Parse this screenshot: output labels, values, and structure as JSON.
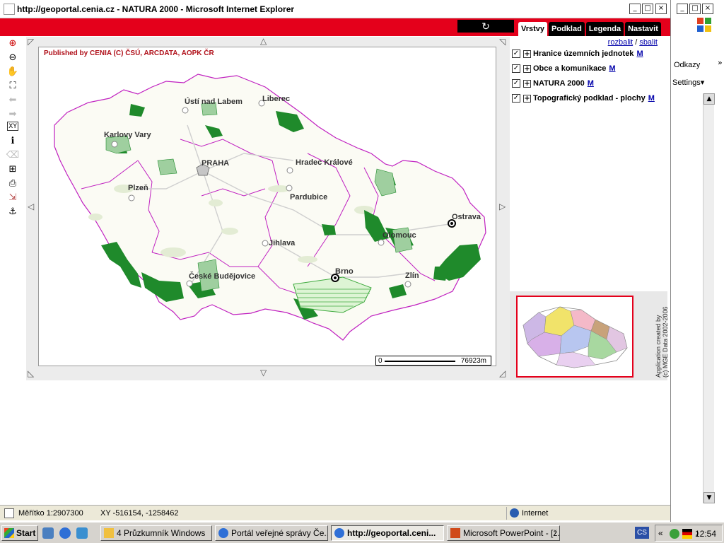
{
  "window": {
    "title": "http://geoportal.cenia.cz - NATURA 2000 - Microsoft Internet Explorer",
    "min": "_",
    "max": "□",
    "close": "×"
  },
  "app": {
    "refresh_glyph": "↻",
    "tabs": [
      {
        "label": "Vrstvy",
        "active": true
      },
      {
        "label": "Podklad",
        "active": false
      },
      {
        "label": "Legenda",
        "active": false
      },
      {
        "label": "Nastavit",
        "active": false
      }
    ]
  },
  "toolbar": {
    "tools": [
      {
        "name": "zoom-in-tool",
        "glyph": "⊕"
      },
      {
        "name": "zoom-out-tool",
        "glyph": "⊖"
      },
      {
        "name": "pan-tool",
        "glyph": "✋"
      },
      {
        "name": "full-extent-tool",
        "glyph": "⛶"
      },
      {
        "name": "back-tool",
        "glyph": "⬅"
      },
      {
        "name": "forward-tool",
        "glyph": "➡"
      },
      {
        "name": "xy-tool",
        "glyph": "XY"
      },
      {
        "name": "info-tool",
        "glyph": "ℹ"
      },
      {
        "name": "eraser-tool",
        "glyph": "⌫"
      },
      {
        "name": "measure-tool",
        "glyph": "⊞"
      },
      {
        "name": "print-tool",
        "glyph": "⎙"
      },
      {
        "name": "export-tool",
        "glyph": "⇲"
      },
      {
        "name": "anchor-tool",
        "glyph": "⚓"
      }
    ]
  },
  "map": {
    "credit": "Published by CENIA    (C) ČSÚ, ARCDATA, AOPK ČR",
    "scale_zero": "0",
    "scale_distance": "76923m",
    "cities": [
      {
        "name": "Ústí nad Labem",
        "key": "usti"
      },
      {
        "name": "Liberec",
        "key": "liberec"
      },
      {
        "name": "Karlovy Vary",
        "key": "kv"
      },
      {
        "name": "PRAHA",
        "key": "praha"
      },
      {
        "name": "Hradec Králové",
        "key": "hk"
      },
      {
        "name": "Plzeň",
        "key": "plzen"
      },
      {
        "name": "Pardubice",
        "key": "pardubice"
      },
      {
        "name": "Ostrava",
        "key": "ostrava"
      },
      {
        "name": "Olomouc",
        "key": "olomouc"
      },
      {
        "name": "Jihlava",
        "key": "jihlava"
      },
      {
        "name": "Brno",
        "key": "brno"
      },
      {
        "name": "Zlín",
        "key": "zlin"
      },
      {
        "name": "České Budějovice",
        "key": "cb"
      }
    ]
  },
  "layers": {
    "expand_label": "rozbalit",
    "separator": " / ",
    "collapse_label": "sbalit",
    "items": [
      {
        "label": "Hranice územních jednotek",
        "meta": "M",
        "checked": true
      },
      {
        "label": "Obce a komunikace",
        "meta": "M",
        "checked": true
      },
      {
        "label": "NATURA 2000",
        "meta": "M",
        "checked": true
      },
      {
        "label": "Topografický podklad - plochy",
        "meta": "M",
        "checked": true
      }
    ]
  },
  "overview": {
    "credit_line1": "Application created by",
    "credit_line2": "(c) MGE Data 2002-2006"
  },
  "statusbar": {
    "scale": "Měřítko 1:2907300",
    "xy": "XY -516154, -1258462",
    "zone": "Internet"
  },
  "win2": {
    "links": "Odkazy",
    "links_chevron": "»",
    "settings": "Settings▾"
  },
  "taskbar": {
    "start": "Start",
    "tasks": [
      {
        "label": "4 Průzkumník Windows",
        "active": false
      },
      {
        "label": "Portál veřejné správy Če...",
        "active": false
      },
      {
        "label": "http://geoportal.ceni...",
        "active": true
      },
      {
        "label": "Microsoft PowerPoint - [ž...",
        "active": false
      }
    ],
    "lang": "CS",
    "tray_chevron": "«",
    "clock": "12:54"
  },
  "colors": {
    "accent_red": "#e4001b",
    "natura_green": "#1f8a2b",
    "border_magenta": "#c020c0"
  }
}
